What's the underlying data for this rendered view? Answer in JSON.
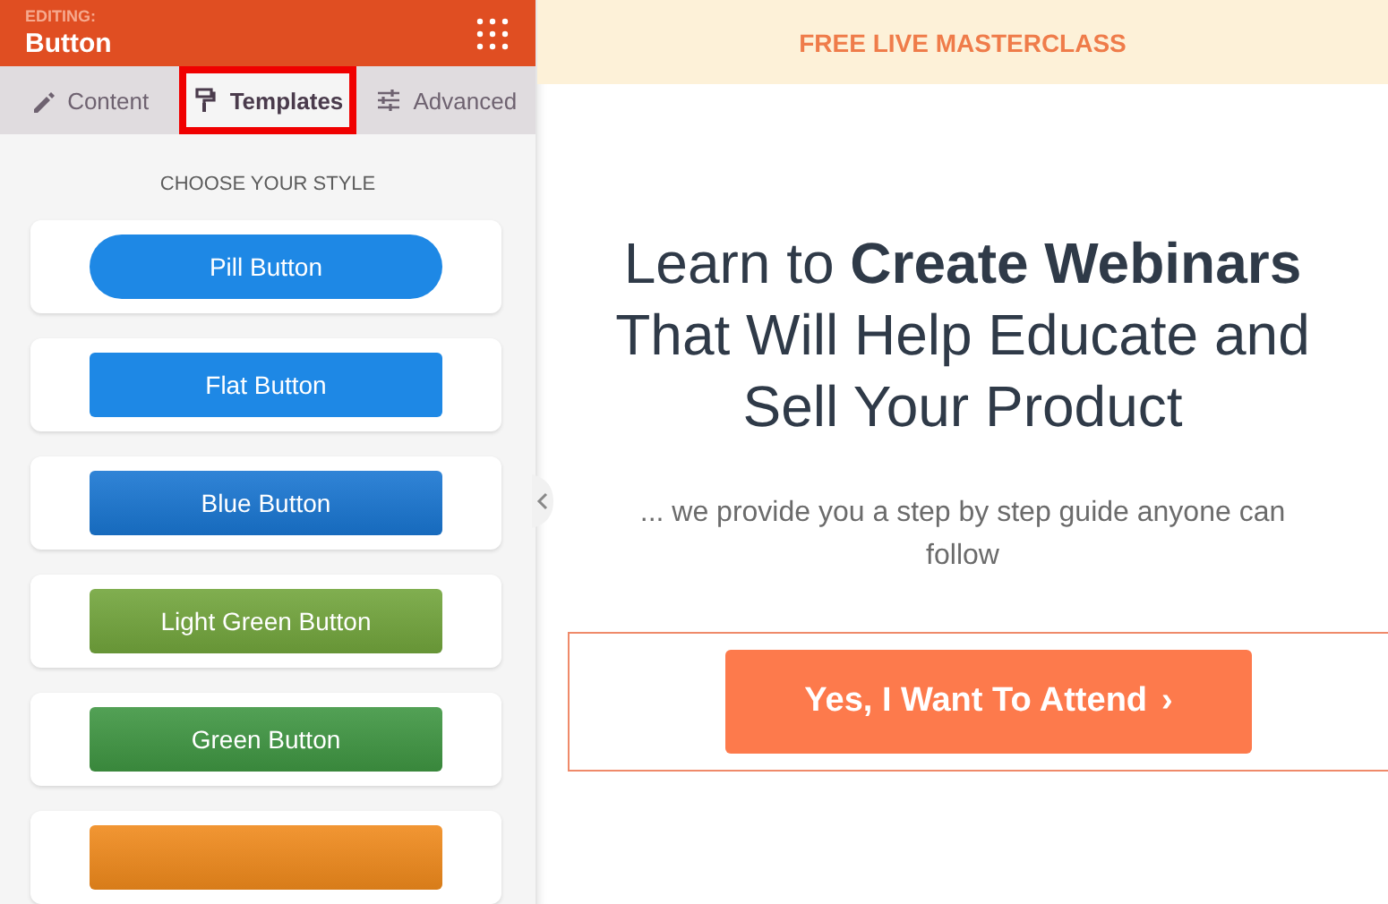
{
  "panel": {
    "editing_label": "EDITING:",
    "element_name": "Button"
  },
  "tabs": [
    {
      "label": "Content",
      "kind": "pencil",
      "selected": false,
      "highlighted": false
    },
    {
      "label": "Templates",
      "kind": "roller",
      "selected": true,
      "highlighted": true
    },
    {
      "label": "Advanced",
      "kind": "sliders",
      "selected": false,
      "highlighted": false
    }
  ],
  "section_title": "CHOOSE YOUR STYLE",
  "templates": [
    {
      "label": "Pill Button",
      "kind": "pill",
      "color": "#1e88e5"
    },
    {
      "label": "Flat Button",
      "kind": "flat",
      "color": "#1e88e5"
    },
    {
      "label": "Blue Button",
      "kind": "gradient",
      "color": "#1976d2"
    },
    {
      "label": "Light Green Button",
      "kind": "gradient",
      "color": "#72a53c"
    },
    {
      "label": "Green Button",
      "kind": "gradient",
      "color": "#3f9642"
    },
    {
      "kind": "gradient",
      "color": "#f08a1c"
    }
  ],
  "page": {
    "banner": "FREE LIVE MASTERCLASS",
    "headline": "Learn to **Create Webinars** That Will Help Educate and Sell Your Product",
    "subheadline": "... we provide you a step by step guide anyone can follow",
    "cta": {
      "label": "Yes, I Want To Attend",
      "chevron": "›",
      "selected": true
    }
  }
}
